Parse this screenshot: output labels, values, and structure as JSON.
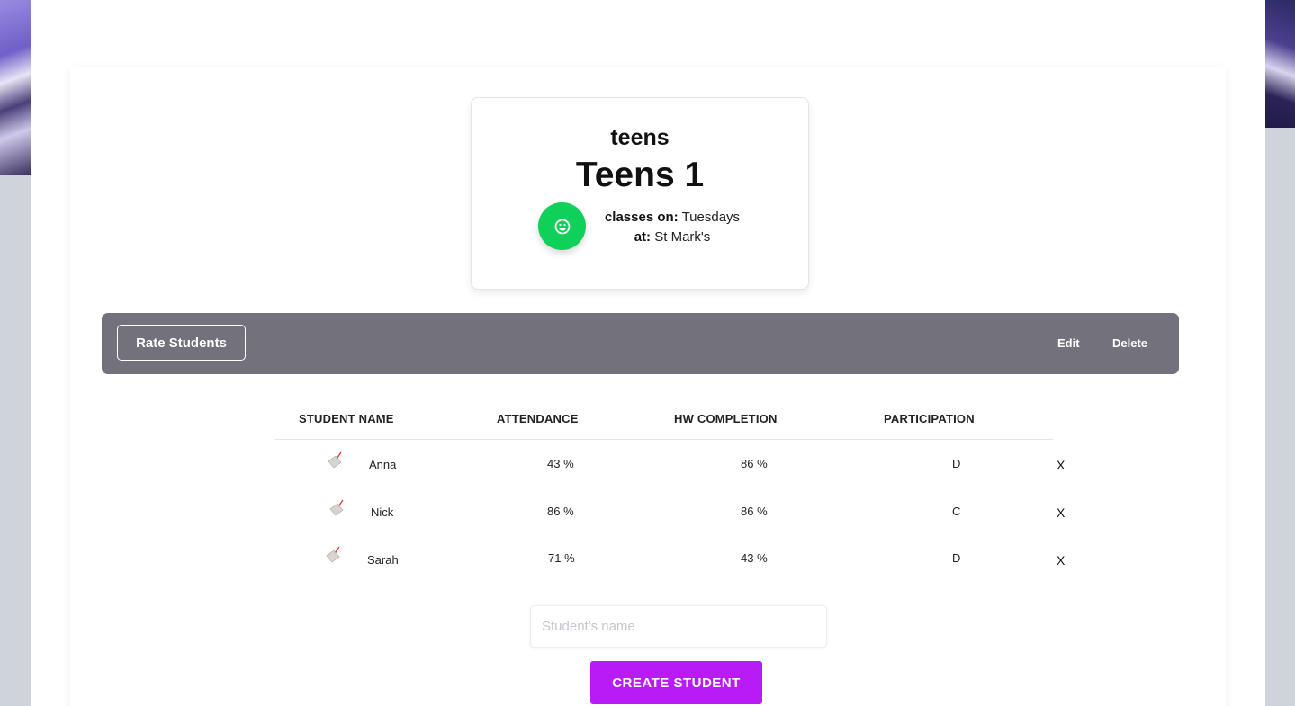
{
  "class": {
    "category": "teens",
    "name": "Teens 1",
    "schedule_label": "classes on:",
    "schedule_value": "Tuesdays",
    "location_label": "at:",
    "location_value": "St Mark's",
    "badge_icon": "smile-icon",
    "badge_color": "#0fd15a"
  },
  "toolbar": {
    "rate_label": "Rate Students",
    "edit_label": "Edit",
    "delete_label": "Delete",
    "background": "#73717b"
  },
  "table": {
    "columns": [
      "STUDENT NAME",
      "ATTENDANCE",
      "HW COMPLETION",
      "PARTICIPATION"
    ],
    "rows": [
      {
        "icon": "tag-icon",
        "name": "Anna",
        "attendance": "43 %",
        "hw": "86 %",
        "participation": "D",
        "remove": "X"
      },
      {
        "icon": "tag-icon",
        "name": "Nick",
        "attendance": "86 %",
        "hw": "86 %",
        "participation": "C",
        "remove": "X"
      },
      {
        "icon": "tag-icon",
        "name": "Sarah",
        "attendance": "71 %",
        "hw": "43 %",
        "participation": "D",
        "remove": "X"
      }
    ]
  },
  "form": {
    "name_placeholder": "Student's name",
    "name_value": "",
    "create_label": "CREATE STUDENT",
    "create_color": "#b81bf6"
  }
}
